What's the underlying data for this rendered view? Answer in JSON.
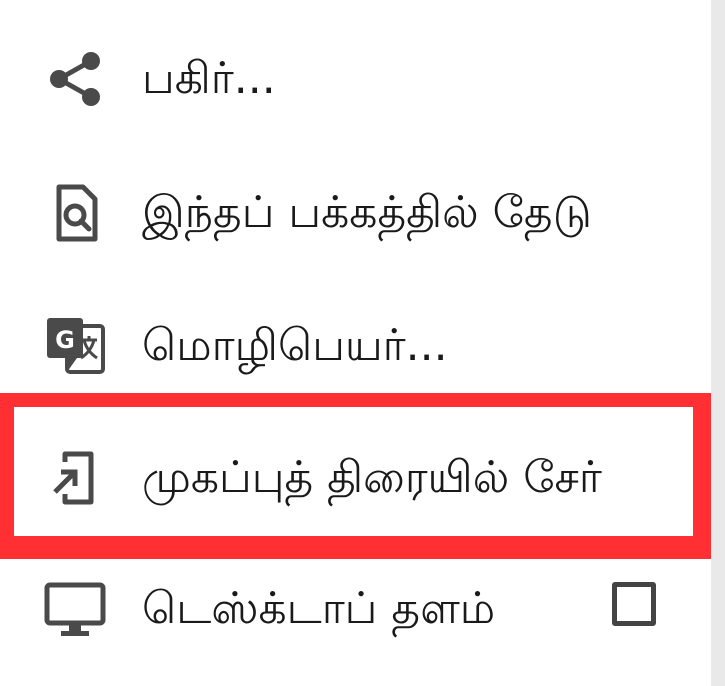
{
  "menu": {
    "items": [
      {
        "id": "share",
        "label": "பகிர்...",
        "icon": "share-icon"
      },
      {
        "id": "find",
        "label": "இந்தப் பக்கத்தில் தேடு",
        "icon": "find-in-page-icon"
      },
      {
        "id": "translate",
        "label": "மொழிபெயர்...",
        "icon": "translate-icon"
      },
      {
        "id": "home",
        "label": "முகப்புத் திரையில் சேர்",
        "icon": "add-to-home-screen-icon",
        "highlighted": true
      },
      {
        "id": "desktop",
        "label": "டெஸ்க்டாப் தளம்",
        "icon": "desktop-icon",
        "checkbox": false
      }
    ]
  },
  "colors": {
    "highlight": "#ff2f34",
    "icon": "#4a4a4a",
    "text": "#1a1a1a"
  }
}
